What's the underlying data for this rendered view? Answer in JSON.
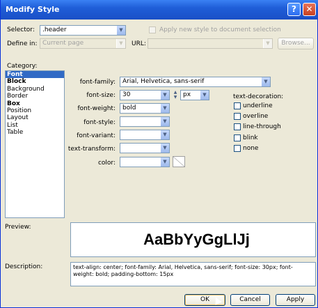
{
  "window": {
    "title": "Modify Style",
    "help_glyph": "?",
    "close_glyph": "✕"
  },
  "selector": {
    "label": "Selector:",
    "value": ".header"
  },
  "apply_new_style": {
    "label": "Apply new style to document selection"
  },
  "define_in": {
    "label": "Define in:",
    "value": "Current page"
  },
  "url": {
    "label": "URL:",
    "value": ""
  },
  "browse_label": "Browse...",
  "category": {
    "label": "Category:",
    "items": [
      "Font",
      "Block",
      "Background",
      "Border",
      "Box",
      "Position",
      "Layout",
      "List",
      "Table"
    ]
  },
  "font": {
    "family_label": "font-family:",
    "family_value": "Arial, Helvetica, sans-serif",
    "size_label": "font-size:",
    "size_value": "30",
    "size_unit": "px",
    "weight_label": "font-weight:",
    "weight_value": "bold",
    "style_label": "font-style:",
    "style_value": "",
    "variant_label": "font-variant:",
    "variant_value": "",
    "transform_label": "text-transform:",
    "transform_value": "",
    "color_label": "color:",
    "color_value": ""
  },
  "text_decoration": {
    "label": "text-decoration:",
    "options": [
      "underline",
      "overline",
      "line-through",
      "blink",
      "none"
    ]
  },
  "preview": {
    "label": "Preview:",
    "sample": "AaBbYyGgLlJj"
  },
  "description": {
    "label": "Description:",
    "text": "text-align: center; font-family: Arial, Helvetica, sans-serif; font-size: 30px; font-weight: bold; padding-bottom: 15px"
  },
  "buttons": {
    "ok": "OK",
    "cancel": "Cancel",
    "apply": "Apply"
  },
  "colors": {
    "titlebar": "#1f5ed8",
    "selection": "#316ac5",
    "dialog": "#ece9d8"
  }
}
